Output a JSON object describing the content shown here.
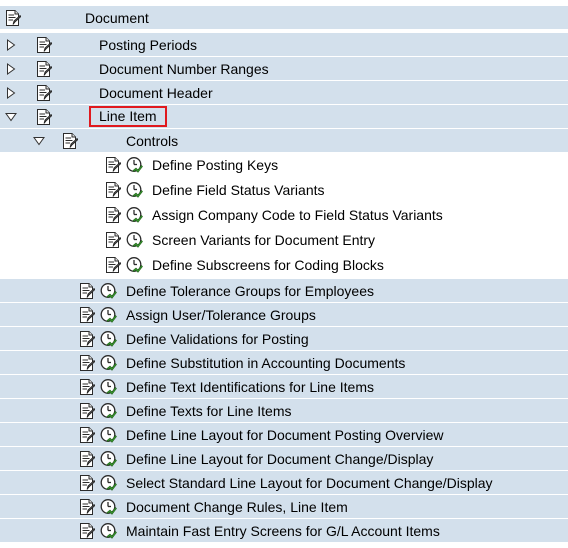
{
  "root": {
    "label": "Document"
  },
  "top_nodes": [
    {
      "label": "Posting Periods",
      "expanded": false
    },
    {
      "label": "Document Number Ranges",
      "expanded": false
    },
    {
      "label": "Document Header",
      "expanded": false
    },
    {
      "label": "Line Item",
      "expanded": true,
      "highlighted": true
    }
  ],
  "controls_node": {
    "label": "Controls",
    "expanded": true
  },
  "controls_items": [
    "Define Posting Keys",
    "Define Field Status Variants",
    "Assign Company Code to Field Status Variants",
    "Screen Variants for Document Entry",
    "Define Subscreens for Coding Blocks"
  ],
  "line_item_activities": [
    "Define Tolerance Groups for Employees",
    "Assign User/Tolerance Groups",
    "Define Validations for Posting",
    "Define Substitution in Accounting Documents",
    "Define Text Identifications for Line Items",
    "Define Texts for Line Items",
    "Define Line Layout for Document Posting Overview",
    "Define Line Layout for Document Change/Display",
    "Select Standard Line Layout for Document Change/Display",
    "Document Change Rules, Line Item",
    "Maintain Fast Entry Screens for G/L Account Items"
  ],
  "colors": {
    "row_blue": "#d3e0ec",
    "highlight_border": "#e0191e",
    "execute_icon_green": "#3a9a2f"
  },
  "icons": {
    "doc": "img-documentation-icon",
    "execute": "execute-clock-icon",
    "collapsed": "triangle-right-icon",
    "expanded": "triangle-down-icon"
  }
}
